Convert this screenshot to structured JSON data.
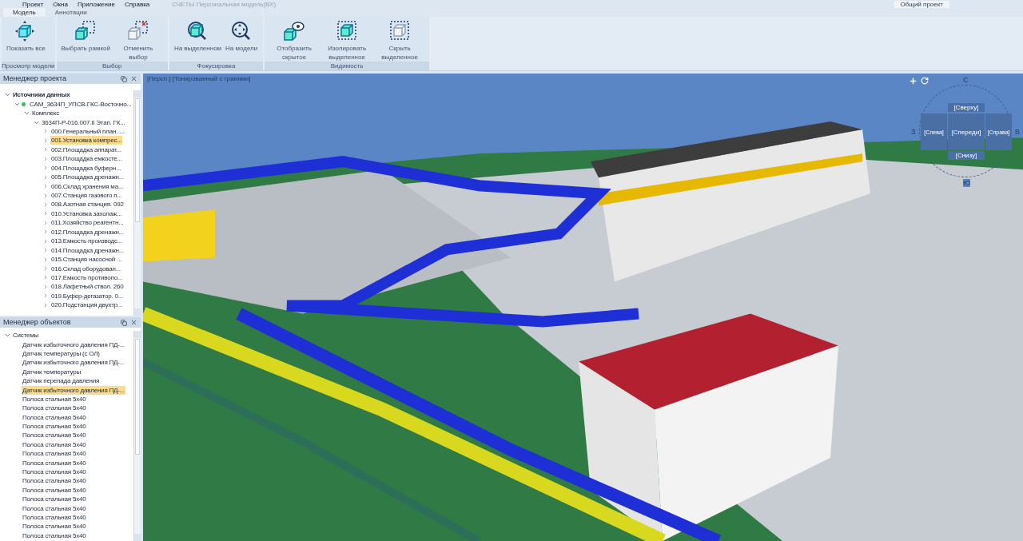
{
  "menu": [
    "Проект",
    "Окна",
    "Приложение",
    "Справка"
  ],
  "window": {
    "title": "СЧЕТЫ Персональная модель(ВХ)",
    "project_button": "Общий проект"
  },
  "tabs": [
    {
      "label": "Модель",
      "selected": true
    },
    {
      "label": "Аннотации",
      "selected": false
    }
  ],
  "ribbon": [
    {
      "title": "Просмотр модели",
      "buttons": [
        {
          "label": "Показать все",
          "kind": "show-all"
        }
      ]
    },
    {
      "title": "Выбор",
      "buttons": [
        {
          "label": "Выбрать рамкой",
          "kind": "box-select"
        },
        {
          "label": "Отменить выбор",
          "kind": "deselect"
        }
      ]
    },
    {
      "title": "Фокусировка",
      "buttons": [
        {
          "label": "На выделенном",
          "kind": "zoom-selected"
        },
        {
          "label": "На модели",
          "kind": "zoom-model"
        }
      ]
    },
    {
      "title": "Видимость",
      "buttons": [
        {
          "label": "Отобразить скрытое",
          "kind": "show-hidden"
        },
        {
          "label": "Изолировать выделенное",
          "kind": "isolate"
        },
        {
          "label": "Скрыть выделенное",
          "kind": "hide"
        }
      ]
    }
  ],
  "project_manager": {
    "title": "Менеджер проекта",
    "tree": [
      {
        "label": "Источники данных",
        "bold": true,
        "expanded": true,
        "children": [
          {
            "label": "CAM_3634П_УПСВ-ГКС-Восточно...",
            "color": "#22c55e",
            "expanded": true,
            "children": [
              {
                "label": "Комплекс",
                "expanded": true,
                "children": [
                  {
                    "label": "3634П-Р-016.007.II Этап. ГК...",
                    "expanded": true,
                    "children": [
                      {
                        "label": "000.Генеральный план. ...",
                        "expanded": false,
                        "selected": false
                      },
                      {
                        "label": "001.Установка компрес...",
                        "expanded": false,
                        "selected": true
                      },
                      {
                        "label": "002.Площадка аппарат...",
                        "expanded": false,
                        "selected": false
                      },
                      {
                        "label": "003.Площадка емкосте...",
                        "expanded": false,
                        "selected": false
                      },
                      {
                        "label": "004.Площадка буферн...",
                        "expanded": false,
                        "selected": false
                      },
                      {
                        "label": "005.Площадка дренажн...",
                        "expanded": false,
                        "selected": false
                      },
                      {
                        "label": "006.Склад хранения ма...",
                        "expanded": false,
                        "selected": false
                      },
                      {
                        "label": "007.Станция газового п...",
                        "expanded": false,
                        "selected": false
                      },
                      {
                        "label": "008.Азотная станция. 092",
                        "expanded": false,
                        "selected": false
                      },
                      {
                        "label": "010.Установка захолаж...",
                        "expanded": false,
                        "selected": false
                      },
                      {
                        "label": "011.Хозяйство реагентн...",
                        "expanded": false,
                        "selected": false
                      },
                      {
                        "label": "012.Площадка дренажн...",
                        "expanded": false,
                        "selected": false
                      },
                      {
                        "label": "013.Емкость производс...",
                        "expanded": false,
                        "selected": false
                      },
                      {
                        "label": "014.Площадка дренажн...",
                        "expanded": false,
                        "selected": false
                      },
                      {
                        "label": "015.Станция насосной ...",
                        "expanded": false,
                        "selected": false
                      },
                      {
                        "label": "016.Склад оборудован...",
                        "expanded": false,
                        "selected": false
                      },
                      {
                        "label": "017.Емкость противопо...",
                        "expanded": false,
                        "selected": false
                      },
                      {
                        "label": "018.Лафетный ствол. 260",
                        "expanded": false,
                        "selected": false
                      },
                      {
                        "label": "019.Буфер-дегазатор. 0...",
                        "expanded": false,
                        "selected": false
                      },
                      {
                        "label": "020.Подстанция двухтр...",
                        "expanded": false,
                        "selected": false
                      }
                    ]
                  }
                ]
              }
            ]
          }
        ]
      }
    ]
  },
  "object_manager": {
    "title": "Менеджер объектов",
    "tree": [
      {
        "label": "Системы",
        "expanded": true,
        "children": [
          {
            "label": "Датчик избыточного давления ПД-...",
            "selected": false
          },
          {
            "label": "Датчик температуры (с ОЛ)",
            "selected": false
          },
          {
            "label": "Датчик избыточного давления ПД-...",
            "selected": false
          },
          {
            "label": "Датчик температуры",
            "selected": false
          },
          {
            "label": "Датчик перепада давления",
            "selected": false
          },
          {
            "label": "Датчик избыточного давления ПД-...",
            "selected": true
          },
          {
            "label": "Полоса стальная 5х40",
            "selected": false
          },
          {
            "label": "Полоса стальная 5х40",
            "selected": false
          },
          {
            "label": "Полоса стальная 5х40",
            "selected": false
          },
          {
            "label": "Полоса стальная 5х40",
            "selected": false
          },
          {
            "label": "Полоса стальная 5х40",
            "selected": false
          },
          {
            "label": "Полоса стальная 5х40",
            "selected": false
          },
          {
            "label": "Полоса стальная 5х40",
            "selected": false
          },
          {
            "label": "Полоса стальная 5х40",
            "selected": false
          },
          {
            "label": "Полоса стальная 5х40",
            "selected": false
          },
          {
            "label": "Полоса стальная 5х40",
            "selected": false
          },
          {
            "label": "Полоса стальная 5х40",
            "selected": false
          },
          {
            "label": "Полоса стальная 5х40",
            "selected": false
          },
          {
            "label": "Полоса стальная 5х40",
            "selected": false
          },
          {
            "label": "Полоса стальная 5х40",
            "selected": false
          },
          {
            "label": "Полоса стальная 5х40",
            "selected": false
          },
          {
            "label": "Полоса стальная 5х40",
            "selected": false
          }
        ]
      }
    ]
  },
  "viewport": {
    "mode_label": "[Персп.] [Тонированный с гранями]",
    "view_cube": {
      "top": "[Сверху]",
      "front": "[Спереди]",
      "left": "[Слева]",
      "right": "[Справа]",
      "bottom": "[Снизу]"
    },
    "compass": {
      "north": "С",
      "west": "З",
      "east": "В",
      "south": "Ю"
    }
  }
}
